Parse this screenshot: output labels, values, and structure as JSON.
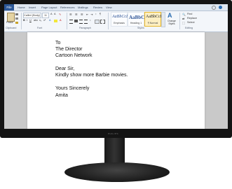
{
  "ribbon_tabs": [
    "File",
    "Home",
    "Insert",
    "Page Layout",
    "References",
    "Mailings",
    "Review",
    "View"
  ],
  "clipboard": {
    "paste_label": "Paste",
    "group_label": "Clipboard"
  },
  "font": {
    "name": "Calibri (Body)",
    "size": "11",
    "group_label": "Font"
  },
  "paragraph": {
    "group_label": "Paragraph"
  },
  "styles": {
    "sample": "AaBbCcDc",
    "items": [
      {
        "sample": "AaBbCcDc",
        "name": "Emphasis"
      },
      {
        "sample": "AaBbCc",
        "name": "Heading 1"
      },
      {
        "sample": "AaBbCcDc",
        "name": "¶ Normal"
      }
    ],
    "change_styles_label": "Change Styles",
    "group_label": "Styles"
  },
  "editing": {
    "find_label": "Find",
    "replace_label": "Replace",
    "select_label": "Select",
    "group_label": "Editing"
  },
  "document": {
    "lines": [
      "To",
      "The Director",
      "Cartoon Network",
      "Dear Sir,",
      "Kindly show more Barbie movies.",
      "Yours Sincerely",
      "Amita"
    ]
  },
  "monitor": {
    "brand": "PHILIPS"
  },
  "colors": {
    "file_tab": "#2b5797",
    "frame": "#141414",
    "style_accent": "#2f5597"
  }
}
